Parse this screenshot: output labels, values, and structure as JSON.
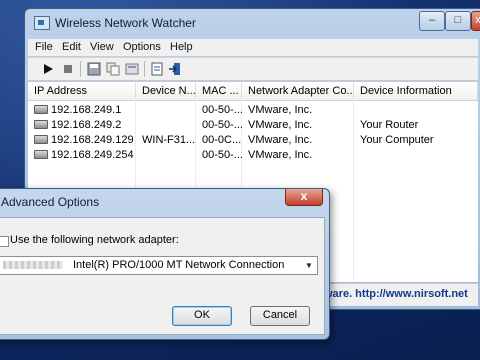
{
  "window": {
    "title": "Wireless Network Watcher",
    "min_glyph": "–",
    "max_glyph": "□",
    "close_glyph": "x"
  },
  "menu": [
    "File",
    "Edit",
    "View",
    "Options",
    "Help"
  ],
  "toolbar": {
    "icons": [
      "play-icon",
      "stop-icon",
      "save-icon",
      "copy-icon",
      "html-report-icon",
      "properties-icon",
      "exit-icon"
    ]
  },
  "table": {
    "columns": [
      "IP Address",
      "Device N...",
      "MAC ...",
      "Network Adapter Co...",
      "Device Information"
    ],
    "rows": [
      {
        "ip": "192.168.249.1",
        "device": "",
        "mac": "00-50-...",
        "adapter": "VMware, Inc.",
        "info": ""
      },
      {
        "ip": "192.168.249.2",
        "device": "",
        "mac": "00-50-...",
        "adapter": "VMware, Inc.",
        "info": "Your Router"
      },
      {
        "ip": "192.168.249.129",
        "device": "WIN-F31...",
        "mac": "00-0C...",
        "adapter": "VMware, Inc.",
        "info": "Your Computer"
      },
      {
        "ip": "192.168.249.254",
        "device": "",
        "mac": "00-50-...",
        "adapter": "VMware, Inc.",
        "info": ""
      }
    ]
  },
  "status": {
    "link_text": "ware.  http://www.nirsoft.net"
  },
  "dialog": {
    "title": "Advanced Options",
    "close_glyph": "x",
    "checkbox_label": "Use the following network adapter:",
    "checkbox_checked": false,
    "adapter_selected": "Intel(R) PRO/1000 MT Network Connection",
    "ok_label": "OK",
    "cancel_label": "Cancel"
  }
}
